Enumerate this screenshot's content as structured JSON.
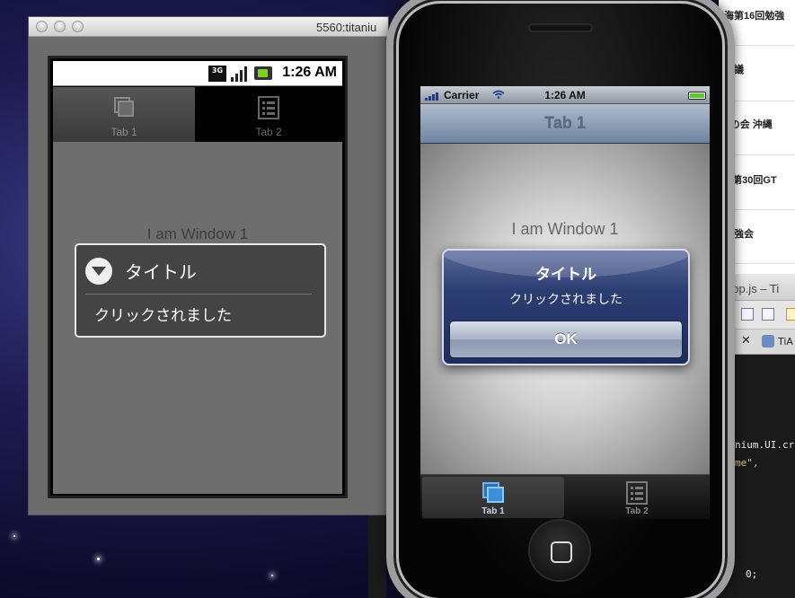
{
  "desktop": {
    "right_window_items": [
      "海第16回勉強",
      "会議",
      "dの会 沖縄",
      "3 第30回GT",
      "勉強会"
    ],
    "editor_title": "app.js – Ti",
    "editor_tab_label": "TiA",
    "code_lines": [
      "nium.UI.cr",
      "me\",",
      "0;"
    ]
  },
  "android_emulator": {
    "window_title": "5560:titaniu",
    "status_time": "1:26 AM",
    "network_badge": "3G",
    "tabs": [
      {
        "label": "Tab 1",
        "active": true
      },
      {
        "label": "Tab 2",
        "active": false
      }
    ],
    "window_label": "I am Window 1",
    "dialog": {
      "title": "タイトル",
      "message": "クリックされました"
    }
  },
  "iphone": {
    "carrier": "Carrier",
    "status_time": "1:26 AM",
    "nav_title": "Tab 1",
    "window_label": "I am Window 1",
    "alert": {
      "title": "タイトル",
      "message": "クリックされました",
      "ok_label": "OK"
    },
    "tabs": [
      {
        "label": "Tab 1",
        "active": true
      },
      {
        "label": "Tab 2",
        "active": false
      }
    ]
  },
  "colors": {
    "android_active_tab": "#555555",
    "ios_alert_blue": "#2c3d72",
    "ios_tab_active_icon": "#3f8fd8"
  }
}
